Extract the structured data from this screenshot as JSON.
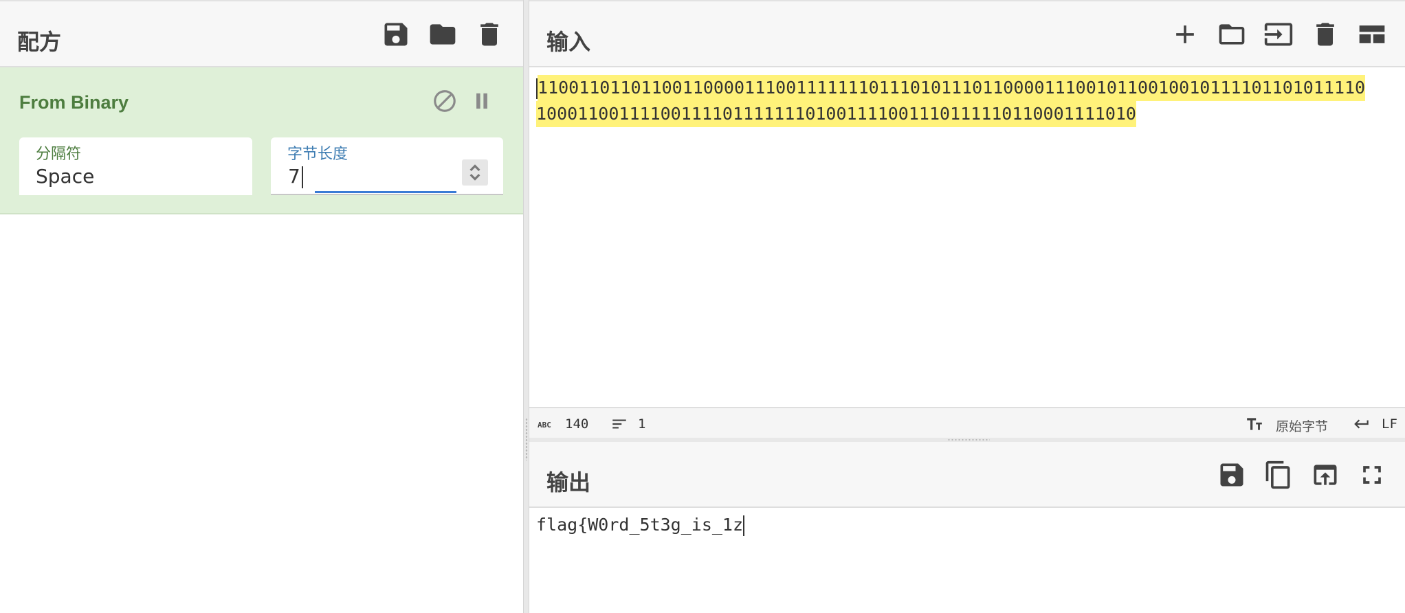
{
  "recipe": {
    "title": "配方",
    "icons": [
      "save-icon",
      "folder-icon",
      "trash-icon"
    ],
    "operation": {
      "name": "From Binary",
      "controls": [
        "disable-icon",
        "pause-icon"
      ],
      "args": {
        "delimiter_label": "分隔符",
        "delimiter_value": "Space",
        "byte_length_label": "字节长度",
        "byte_length_value": "7"
      }
    }
  },
  "input": {
    "title": "输入",
    "icons": [
      "plus-icon",
      "folder-icon",
      "input-arrow-icon",
      "trash-icon",
      "layout-icon"
    ],
    "text_line1": "11001101101100110000111001111111011101011101100001110010110010010111101101011110",
    "text_line2": "1000110011110011110111111101001111001110111110110001111010",
    "status": {
      "length": "140",
      "lines": "1",
      "encoding": "原始字节",
      "eol": "LF"
    }
  },
  "output": {
    "title": "输出",
    "icons": [
      "save-icon",
      "copy-icon",
      "replace-input-icon",
      "fullscreen-icon"
    ],
    "text": "flag{W0rd_5t3g_is_1z"
  },
  "colors": {
    "operation_bg": "#dff0d8",
    "operation_text": "#4d7d3f",
    "highlight": "#fff27a",
    "focus": "#3a7bd5"
  }
}
